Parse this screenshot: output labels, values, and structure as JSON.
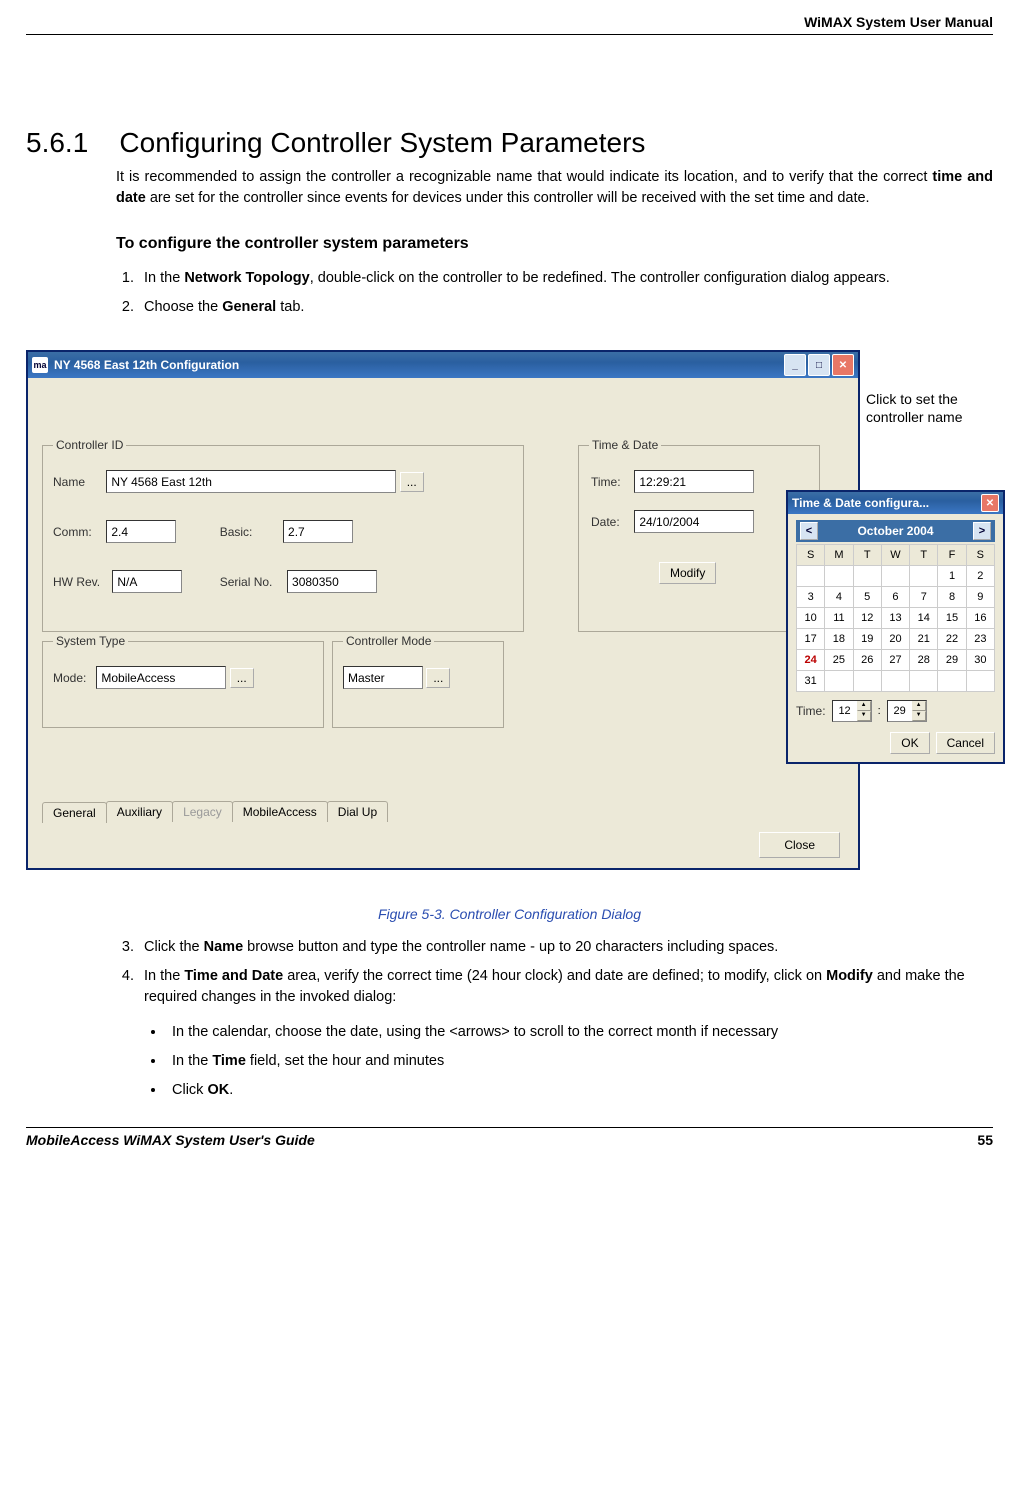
{
  "header": {
    "right": "WiMAX System User Manual"
  },
  "section": {
    "num": "5.6.1",
    "title": "Configuring Controller System Parameters"
  },
  "para1": "It is recommended to assign the controller a recognizable name that would indicate its location, and to verify that the correct ",
  "para1_bold": "time and date",
  "para1_cont": " are set for the controller since events for devices under this controller will be received with the set time and date.",
  "sub_heading": "To configure the controller system parameters",
  "step1_a": "In the ",
  "step1_bold": "Network Topology",
  "step1_b": ", double-click on the controller to be redefined.  The controller configuration dialog appears.",
  "step2_a": "Choose the ",
  "step2_bold": "General",
  "step2_b": " tab.",
  "callout": "Click to set the controller name",
  "dialog": {
    "title": "NY 4568 East 12th Configuration",
    "icon": "ma",
    "group_cid": "Controller ID",
    "name_label": "Name",
    "name_value": "NY 4568 East 12th",
    "comm_label": "Comm:",
    "comm_value": "2.4",
    "basic_label": "Basic:",
    "basic_value": "2.7",
    "hw_label": "HW Rev.",
    "hw_value": "N/A",
    "serial_label": "Serial No.",
    "serial_value": "3080350",
    "group_td": "Time & Date",
    "time_label": "Time:",
    "time_value": "12:29:21",
    "date_label": "Date:",
    "date_value": "24/10/2004",
    "modify_btn": "Modify",
    "group_st": "System Type",
    "mode_label": "Mode:",
    "mode_value": "MobileAccess",
    "group_cm": "Controller Mode",
    "cm_value": "Master",
    "tabs": [
      "General",
      "Auxiliary",
      "Legacy",
      "MobileAccess",
      "Dial Up"
    ],
    "close_btn": "Close",
    "browse": "..."
  },
  "popup": {
    "title": "Time & Date configura...",
    "month": "October   2004",
    "dows": [
      "S",
      "M",
      "T",
      "W",
      "T",
      "F",
      "S"
    ],
    "weeks": [
      [
        "",
        "",
        "",
        "",
        "",
        "1",
        "2"
      ],
      [
        "3",
        "4",
        "5",
        "6",
        "7",
        "8",
        "9"
      ],
      [
        "10",
        "11",
        "12",
        "13",
        "14",
        "15",
        "16"
      ],
      [
        "17",
        "18",
        "19",
        "20",
        "21",
        "22",
        "23"
      ],
      [
        "24",
        "25",
        "26",
        "27",
        "28",
        "29",
        "30"
      ],
      [
        "31",
        "",
        "",
        "",
        "",
        "",
        ""
      ]
    ],
    "today": "24",
    "time_label": "Time:",
    "hour": "12",
    "min": "29",
    "ok": "OK",
    "cancel": "Cancel"
  },
  "fig_caption": "Figure 5-3. Controller Configuration Dialog",
  "step3_a": "Click the ",
  "step3_bold": "Name",
  "step3_b": " browse button and type the controller name - up to 20 characters including spaces.",
  "step4_a": "In the ",
  "step4_bold": "Time and Date",
  "step4_b": " area, verify the correct time (24 hour clock) and date are defined; to modify, click on ",
  "step4_bold2": "Modify",
  "step4_c": " and make the required changes in the invoked dialog:",
  "bullet1": "In the calendar, choose the date, using the <arrows> to scroll to the correct month if necessary",
  "bullet2_a": "In the ",
  "bullet2_bold": "Time",
  "bullet2_b": " field, set the hour and minutes",
  "bullet3_a": "Click ",
  "bullet3_bold": "OK",
  "bullet3_b": ".",
  "footer": {
    "left": "MobileAccess WiMAX System User's Guide",
    "page": "55"
  }
}
